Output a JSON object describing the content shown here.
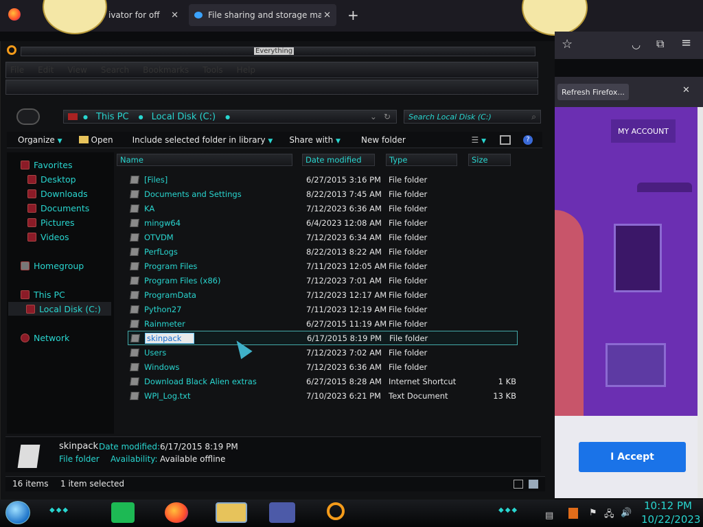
{
  "browser": {
    "tabs": [
      {
        "label": "ivator for off"
      },
      {
        "label": "File sharing and storage made s"
      }
    ],
    "notification": "Refresh Firefox...",
    "content": {
      "my_account": "MY ACCOUNT",
      "accept_button": "I Accept"
    }
  },
  "search_bar": {
    "label": "Everything"
  },
  "menu": [
    "File",
    "Edit",
    "View",
    "Search",
    "Bookmarks",
    "Tools",
    "Help"
  ],
  "address": {
    "crumbs": [
      "This PC",
      "Local Disk (C:)"
    ],
    "search_placeholder": "Search Local Disk (C:)"
  },
  "toolbar": {
    "organize": "Organize",
    "open": "Open",
    "include": "Include selected folder in library",
    "share": "Share with",
    "new_folder": "New folder"
  },
  "sidebar": {
    "favorites": "Favorites",
    "favorites_items": [
      "Desktop",
      "Downloads",
      "Documents",
      "Pictures",
      "Videos"
    ],
    "homegroup": "Homegroup",
    "this_pc": "This PC",
    "local_disk": "Local Disk (C:)",
    "network": "Network"
  },
  "columns": {
    "name": "Name",
    "date": "Date modified",
    "type": "Type",
    "size": "Size"
  },
  "files": [
    {
      "name": "[Files]",
      "date": "6/27/2015 3:16 PM",
      "type": "File folder",
      "size": ""
    },
    {
      "name": "Documents and Settings",
      "date": "8/22/2013 7:45 AM",
      "type": "File folder",
      "size": ""
    },
    {
      "name": "KA",
      "date": "7/12/2023 6:36 AM",
      "type": "File folder",
      "size": ""
    },
    {
      "name": "mingw64",
      "date": "6/4/2023 12:08 AM",
      "type": "File folder",
      "size": ""
    },
    {
      "name": "OTVDM",
      "date": "7/12/2023 6:34 AM",
      "type": "File folder",
      "size": ""
    },
    {
      "name": "PerfLogs",
      "date": "8/22/2013 8:22 AM",
      "type": "File folder",
      "size": ""
    },
    {
      "name": "Program Files",
      "date": "7/11/2023 12:05 AM",
      "type": "File folder",
      "size": ""
    },
    {
      "name": "Program Files (x86)",
      "date": "7/12/2023 7:01 AM",
      "type": "File folder",
      "size": ""
    },
    {
      "name": "ProgramData",
      "date": "7/12/2023 12:17 AM",
      "type": "File folder",
      "size": ""
    },
    {
      "name": "Python27",
      "date": "7/11/2023 12:19 AM",
      "type": "File folder",
      "size": ""
    },
    {
      "name": "Rainmeter",
      "date": "6/27/2015 11:19 AM",
      "type": "File folder",
      "size": ""
    },
    {
      "name": "skinpack",
      "date": "6/17/2015 8:19 PM",
      "type": "File folder",
      "size": ""
    },
    {
      "name": "Users",
      "date": "7/12/2023 7:02 AM",
      "type": "File folder",
      "size": ""
    },
    {
      "name": "Windows",
      "date": "7/12/2023 6:36 AM",
      "type": "File folder",
      "size": ""
    },
    {
      "name": "Download Black Alien extras",
      "date": "6/27/2015 8:28 AM",
      "type": "Internet Shortcut",
      "size": "1 KB"
    },
    {
      "name": "WPI_Log.txt",
      "date": "7/10/2023 6:21 PM",
      "type": "Text Document",
      "size": "13 KB"
    }
  ],
  "details": {
    "name": "skinpack",
    "kind": "File folder",
    "date_label": "Date modified:",
    "date_value": "6/17/2015 8:19 PM",
    "avail_label": "Availability:",
    "avail_value": "Available offline"
  },
  "status": {
    "items": "16 items",
    "selected": "1 item selected"
  },
  "clock": {
    "time": "10:12 PM",
    "date": "10/22/2023"
  },
  "colors": {
    "accent": "#29d6d0",
    "firefox_purple": "#6b2fb2",
    "accept_blue": "#1a73e8"
  }
}
